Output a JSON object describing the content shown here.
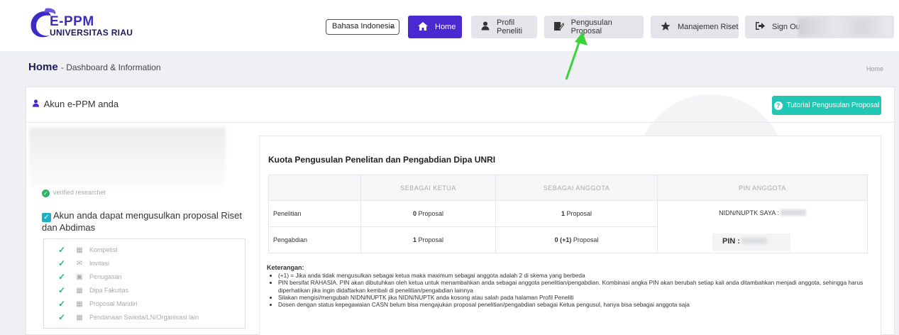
{
  "brand": {
    "line1": "E-PPM",
    "line2": "UNIVERSITAS RIAU"
  },
  "language": {
    "selected": "Bahasa Indonesia"
  },
  "nav": {
    "home": "Home",
    "profil": "Profil Peneliti",
    "pengusulan": "Pengusulan Proposal",
    "manajemen": "Manajemen Riset",
    "signout": "Sign Out"
  },
  "header": {
    "title": "Home",
    "subtitle": "Dashboard & Information",
    "breadcrumb": "Home"
  },
  "account": {
    "heading": "Akun e-PPM anda",
    "tutorial_button": "Tutorial Pengusulan Proposal",
    "verified": "verified researcher",
    "eligible": "Akun anda dapat mengusulkan proposal Riset dan Abdimas",
    "menu": [
      "Kompetisi",
      "Invitasi",
      "Penugasan",
      "Dipa Fakultas",
      "Proposal Mandiri",
      "Pendanaan Swasta/LN/Organisasi lain"
    ]
  },
  "quota": {
    "title": "Kuota Pengusulan Penelitan dan Pengabdian Dipa UNRI",
    "columns": [
      "SEBAGAI KETUA",
      "SEBAGAI ANGGOTA",
      "PIN ANGGOTA"
    ],
    "rows": [
      {
        "label": "Penelitian",
        "ketua_num": "0",
        "ketua_unit": "Proposal",
        "anggota_num": "1",
        "anggota_unit": "Proposal"
      },
      {
        "label": "Pengabdian",
        "ketua_num": "1",
        "ketua_unit": "Proposal",
        "anggota_num": "0 (+1)",
        "anggota_unit": "Proposal"
      }
    ],
    "nidn_label": "NIDN/NUPTK SAYA :",
    "pin_label": "PIN :"
  },
  "notes": {
    "heading": "Keterangan:",
    "items": [
      "(+1) = Jika anda tidak mengusulkan sebagai ketua maka maximum sebagai anggota adalah 2 di skema yang berbeda",
      "PIN bersifat RAHASIA. PIN akan dibutuhkan oleh ketua untuk menambahkan anda sebagai anggota penelitian/pengabdian. Kombinasi angka PIN akan berubah setiap kali anda ditambahkan menjadi anggota, sehingga harus diperhatikan jika ingin didaftarkan kembali di penelitian/pengabdian lainnya",
      "Silakan mengisi/mengubah NIDN/NUPTK jika NIDN/NUPTK anda kosong atau salah pada halaman Profil Peneliti",
      "Dosen dengan status kepegawaian CASN belum bisa mengajukan proposal penelitian/pengabdian sebagai Ketua pengusul, hanya bisa sebagai anggota saja"
    ]
  },
  "colors": {
    "primary": "#4a2ad0",
    "teal": "#1fc7b4",
    "success": "#2bb56b",
    "annotation_arrow": "#3ad33a"
  },
  "icons": [
    "home-icon",
    "user-icon",
    "edit-document-icon",
    "star-icon",
    "sign-out-icon",
    "help-circle-icon",
    "check-icon",
    "sitemap-icon",
    "envelope-icon",
    "square-icon"
  ]
}
